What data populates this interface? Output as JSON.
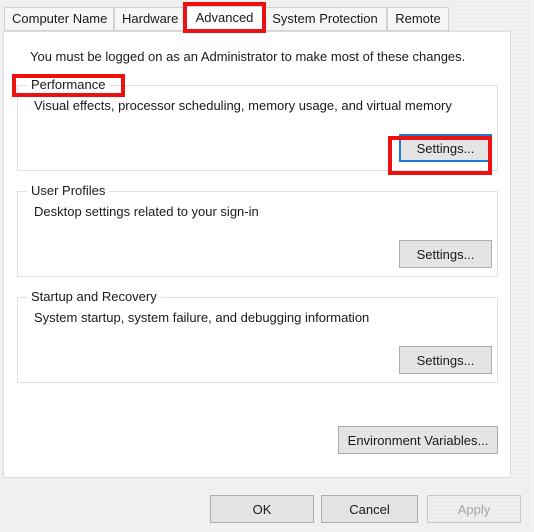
{
  "dialog": {
    "intro_text": "You must be logged on as an Administrator to make most of these changes."
  },
  "tabs": [
    {
      "label": "Computer Name",
      "selected": false
    },
    {
      "label": "Hardware",
      "selected": false
    },
    {
      "label": "Advanced",
      "selected": true
    },
    {
      "label": "System Protection",
      "selected": false
    },
    {
      "label": "Remote",
      "selected": false
    }
  ],
  "groups": {
    "performance": {
      "legend": "Performance",
      "description": "Visual effects, processor scheduling, memory usage, and virtual memory",
      "button_label": "Settings..."
    },
    "user_profiles": {
      "legend": "User Profiles",
      "description": "Desktop settings related to your sign-in",
      "button_label": "Settings..."
    },
    "startup_recovery": {
      "legend": "Startup and Recovery",
      "description": "System startup, system failure, and debugging information",
      "button_label": "Settings..."
    }
  },
  "environment_variables": {
    "button_label": "Environment Variables..."
  },
  "footer": {
    "ok_label": "OK",
    "cancel_label": "Cancel",
    "apply_label": "Apply"
  },
  "colors": {
    "annotation_red": "#ee1111",
    "focus_blue": "#1e7ad4",
    "panel_background": "#ffffff",
    "dialog_background": "#f1f1f1",
    "button_face": "#e4e4e4"
  }
}
